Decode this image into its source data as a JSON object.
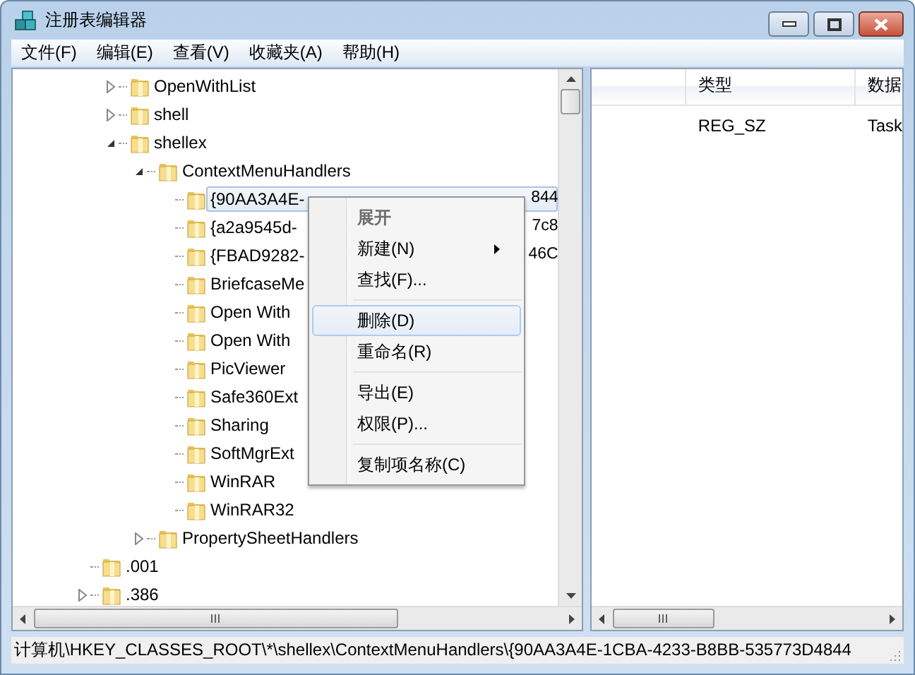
{
  "window": {
    "title": "注册表编辑器"
  },
  "menu_bar": [
    "文件(F)",
    "编辑(E)",
    "查看(V)",
    "收藏夹(A)",
    "帮助(H)"
  ],
  "tree": {
    "items": [
      {
        "kind": "continuation",
        "children": [
          {
            "kind": "key",
            "label": "OpenWithList",
            "expanded": false,
            "selected": false
          },
          {
            "kind": "key",
            "label": "shell",
            "expanded": false,
            "selected": false
          },
          {
            "kind": "key",
            "label": "shellex",
            "expanded": true,
            "selected": false,
            "children": [
              {
                "kind": "key",
                "label": "ContextMenuHandlers",
                "expanded": true,
                "selected": false,
                "children": [
                  {
                    "kind": "leaf",
                    "label": "{90AA3A4E-",
                    "tail": "844",
                    "selected": true
                  },
                  {
                    "kind": "leaf",
                    "label": "{a2a9545d-",
                    "tail": "7c8",
                    "selected": false
                  },
                  {
                    "kind": "leaf",
                    "label": "{FBAD9282-",
                    "tail": "46C",
                    "selected": false
                  },
                  {
                    "kind": "leaf",
                    "label": "BriefcaseMe",
                    "selected": false
                  },
                  {
                    "kind": "leaf",
                    "label": "Open With",
                    "selected": false
                  },
                  {
                    "kind": "leaf",
                    "label": "Open With",
                    "selected": false
                  },
                  {
                    "kind": "leaf",
                    "label": "PicViewer",
                    "selected": false
                  },
                  {
                    "kind": "leaf",
                    "label": "Safe360Ext",
                    "selected": false
                  },
                  {
                    "kind": "leaf",
                    "label": "Sharing",
                    "selected": false
                  },
                  {
                    "kind": "leaf",
                    "label": "SoftMgrExt",
                    "selected": false
                  },
                  {
                    "kind": "leaf",
                    "label": "WinRAR",
                    "selected": false
                  },
                  {
                    "kind": "leaf",
                    "label": "WinRAR32",
                    "selected": false
                  }
                ]
              },
              {
                "kind": "key",
                "label": "PropertySheetHandlers",
                "expanded": false,
                "selected": false
              }
            ]
          }
        ]
      },
      {
        "kind": "leaf",
        "label": ".001",
        "selected": false
      },
      {
        "kind": "key",
        "label": ".386",
        "expanded": false,
        "selected": false
      }
    ]
  },
  "values": {
    "columns": [
      "类型",
      "数据"
    ],
    "rows": [
      [
        "REG_SZ",
        "Task"
      ]
    ]
  },
  "context_menu": {
    "items": [
      {
        "kind": "default",
        "label": "展开",
        "disabled": true,
        "selected": false,
        "submenu": false
      },
      {
        "kind": "item",
        "label": "新建(N)",
        "disabled": false,
        "selected": false,
        "submenu": true
      },
      {
        "kind": "item",
        "label": "查找(F)...",
        "disabled": false,
        "selected": false,
        "submenu": false
      },
      {
        "kind": "separator"
      },
      {
        "kind": "item",
        "label": "删除(D)",
        "disabled": false,
        "selected": true,
        "submenu": false
      },
      {
        "kind": "item",
        "label": "重命名(R)",
        "disabled": false,
        "selected": false,
        "submenu": false
      },
      {
        "kind": "separator"
      },
      {
        "kind": "item",
        "label": "导出(E)",
        "disabled": false,
        "selected": false,
        "submenu": false
      },
      {
        "kind": "item",
        "label": "权限(P)...",
        "disabled": false,
        "selected": false,
        "submenu": false
      },
      {
        "kind": "separator"
      },
      {
        "kind": "item",
        "label": "复制项名称(C)",
        "disabled": false,
        "selected": false,
        "submenu": false
      }
    ]
  },
  "status_bar": "计算机\\HKEY_CLASSES_ROOT\\*\\shellex\\ContextMenuHandlers\\{90AA3A4E-1CBA-4233-B8BB-535773D4844"
}
